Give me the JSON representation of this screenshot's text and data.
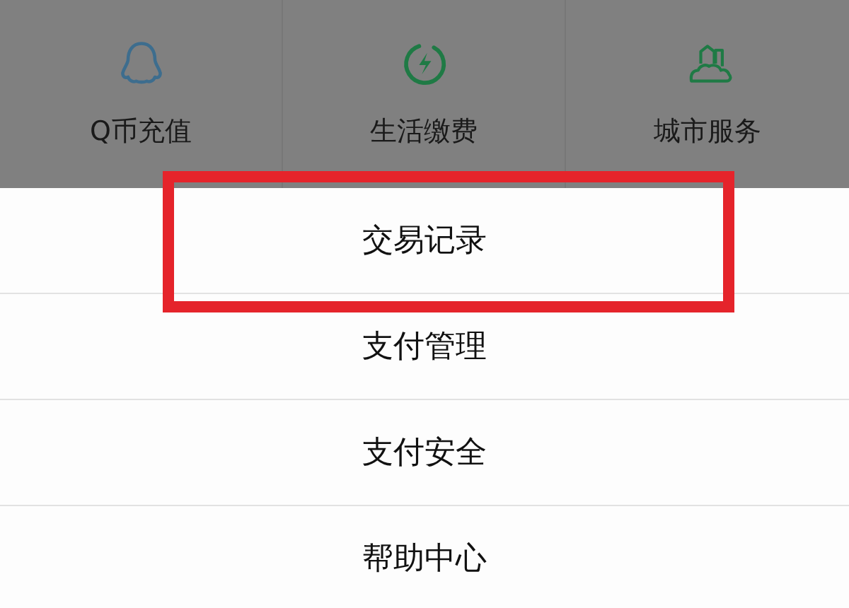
{
  "services": [
    {
      "label": "Q币充值",
      "kind": "penguin",
      "color": "#3d6d8e"
    },
    {
      "label": "生活缴费",
      "kind": "power",
      "color": "#1f7a45"
    },
    {
      "label": "城市服务",
      "kind": "city",
      "color": "#1f7a45"
    }
  ],
  "menu": [
    {
      "label": "交易记录",
      "highlighted": true
    },
    {
      "label": "支付管理",
      "highlighted": false
    },
    {
      "label": "支付安全",
      "highlighted": false
    },
    {
      "label": "帮助中心",
      "highlighted": false
    }
  ]
}
